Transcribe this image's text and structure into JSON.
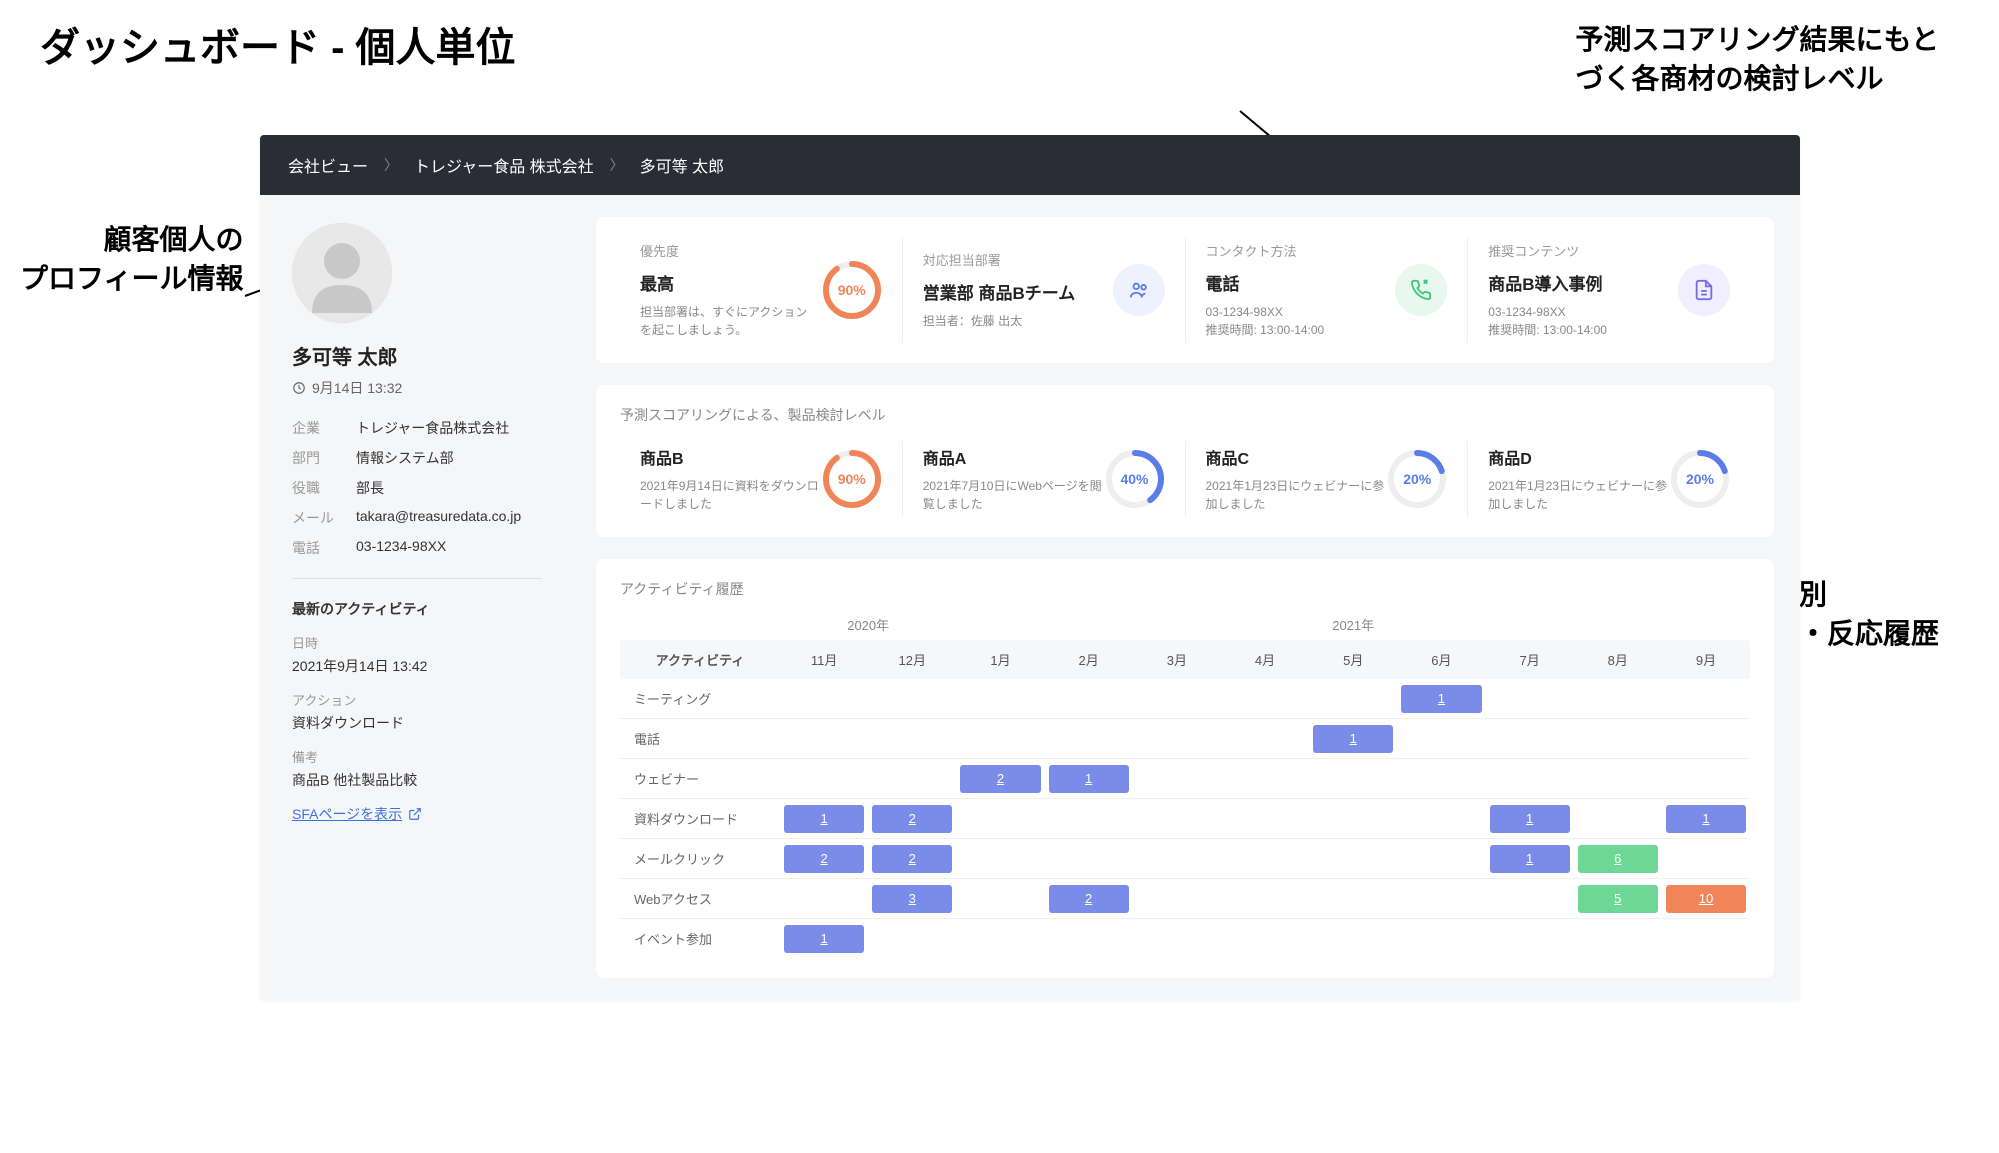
{
  "annotations": {
    "title": "ダッシュボード - 個人単位",
    "right_top": "予測スコアリング結果にもと\nづく各商材の検討レベル",
    "left": "顧客個人の\nプロフィール情報",
    "right_bottom": "接点別\n行動・反応履歴"
  },
  "breadcrumb": {
    "l0": "会社ビュー",
    "l1": "トレジャー食品 株式会社",
    "l2": "多可等 太郎"
  },
  "profile": {
    "name": "多可等 太郎",
    "timestamp": "9月14日 13:32",
    "fields": {
      "company_label": "企業",
      "company": "トレジャー食品株式会社",
      "dept_label": "部門",
      "dept": "情報システム部",
      "role_label": "役職",
      "role": "部長",
      "mail_label": "メール",
      "mail": "takara@treasuredata.co.jp",
      "tel_label": "電話",
      "tel": "03-1234-98XX"
    },
    "activity": {
      "title": "最新のアクティビティ",
      "date_label": "日時",
      "date": "2021年9月14日 13:42",
      "action_label": "アクション",
      "action": "資料ダウンロード",
      "note_label": "備考",
      "note": "商品B 他社製品比較"
    },
    "sfa_link": "SFAページを表示"
  },
  "metrics": {
    "priority": {
      "label": "優先度",
      "value": "最高",
      "sub": "担当部署は、すぐにアクションを起こしましょう。",
      "percent": 90,
      "color": "#f0855a"
    },
    "owner": {
      "label": "対応担当部署",
      "value": "営業部 商品Bチーム",
      "sub": "担当者：佐藤 出太"
    },
    "contact": {
      "label": "コンタクト方法",
      "value": "電話",
      "sub1": "03-1234-98XX",
      "sub2": "推奨時間: 13:00-14:00"
    },
    "content": {
      "label": "推奨コンテンツ",
      "value": "商品B導入事例",
      "sub1": "03-1234-98XX",
      "sub2": "推奨時間: 13:00-14:00"
    }
  },
  "scoring": {
    "title": "予測スコアリングによる、製品検討レベル",
    "items": [
      {
        "name": "商品B",
        "desc": "2021年9月14日に資料をダウンロードしました",
        "percent": 90,
        "color": "#f0855a"
      },
      {
        "name": "商品A",
        "desc": "2021年7月10日にWebページを閲覧しました",
        "percent": 40,
        "color": "#5a7de8"
      },
      {
        "name": "商品C",
        "desc": "2021年1月23日にウェビナーに参加しました",
        "percent": 20,
        "color": "#5a7de8"
      },
      {
        "name": "商品D",
        "desc": "2021年1月23日にウェビナーに参加しました",
        "percent": 20,
        "color": "#5a7de8"
      }
    ]
  },
  "history": {
    "title": "アクティビティ履歴",
    "activity_header": "アクティビティ",
    "years": [
      "2020年",
      "2021年"
    ],
    "year_spans": [
      2,
      9
    ],
    "months": [
      "11月",
      "12月",
      "1月",
      "2月",
      "3月",
      "4月",
      "5月",
      "6月",
      "7月",
      "8月",
      "9月"
    ],
    "rows": [
      {
        "label": "ミーティング",
        "cells": [
          null,
          null,
          null,
          null,
          null,
          null,
          null,
          {
            "v": 1,
            "c": "blue"
          },
          null,
          null,
          null
        ]
      },
      {
        "label": "電話",
        "cells": [
          null,
          null,
          null,
          null,
          null,
          null,
          {
            "v": 1,
            "c": "blue"
          },
          null,
          null,
          null,
          null
        ]
      },
      {
        "label": "ウェビナー",
        "cells": [
          null,
          null,
          {
            "v": 2,
            "c": "blue"
          },
          {
            "v": 1,
            "c": "blue"
          },
          null,
          null,
          null,
          null,
          null,
          null,
          null
        ]
      },
      {
        "label": "資料ダウンロード",
        "cells": [
          {
            "v": 1,
            "c": "blue"
          },
          {
            "v": 2,
            "c": "blue"
          },
          null,
          null,
          null,
          null,
          null,
          null,
          {
            "v": 1,
            "c": "blue"
          },
          null,
          {
            "v": 1,
            "c": "blue"
          }
        ]
      },
      {
        "label": "メールクリック",
        "cells": [
          {
            "v": 2,
            "c": "blue"
          },
          {
            "v": 2,
            "c": "blue"
          },
          null,
          null,
          null,
          null,
          null,
          null,
          {
            "v": 1,
            "c": "blue"
          },
          {
            "v": 6,
            "c": "green"
          },
          null
        ]
      },
      {
        "label": "Webアクセス",
        "cells": [
          null,
          {
            "v": 3,
            "c": "blue"
          },
          null,
          {
            "v": 2,
            "c": "blue"
          },
          null,
          null,
          null,
          null,
          null,
          {
            "v": 5,
            "c": "green"
          },
          {
            "v": 10,
            "c": "orange"
          }
        ]
      },
      {
        "label": "イベント参加",
        "cells": [
          {
            "v": 1,
            "c": "blue"
          },
          null,
          null,
          null,
          null,
          null,
          null,
          null,
          null,
          null,
          null
        ]
      }
    ]
  }
}
